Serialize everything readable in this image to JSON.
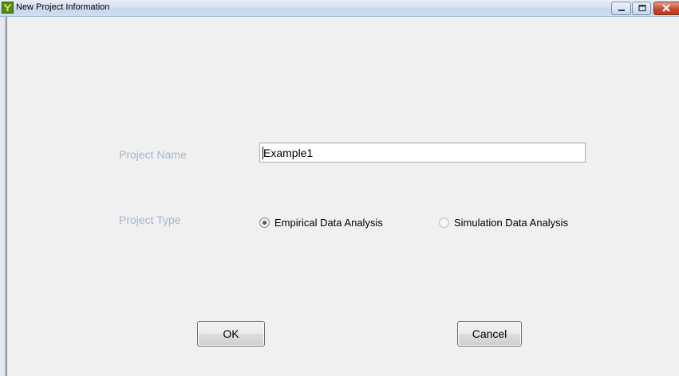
{
  "window": {
    "title": "New Project Information",
    "icon": "app-y-icon",
    "controls": [
      "minimize-icon",
      "maximize-icon",
      "close-icon"
    ]
  },
  "form": {
    "project_name_label": "Project Name",
    "project_name_value": "Example1",
    "project_type_label": "Project Type",
    "project_type_options": [
      {
        "label": "Empirical Data Analysis",
        "selected": true
      },
      {
        "label": "Simulation Data Analysis",
        "selected": false
      }
    ]
  },
  "buttons": {
    "ok_label": "OK",
    "cancel_label": "Cancel"
  },
  "colors": {
    "label_text": "#a6b6cc",
    "close_button": "#c9462c",
    "background": "#f0f0f0"
  }
}
